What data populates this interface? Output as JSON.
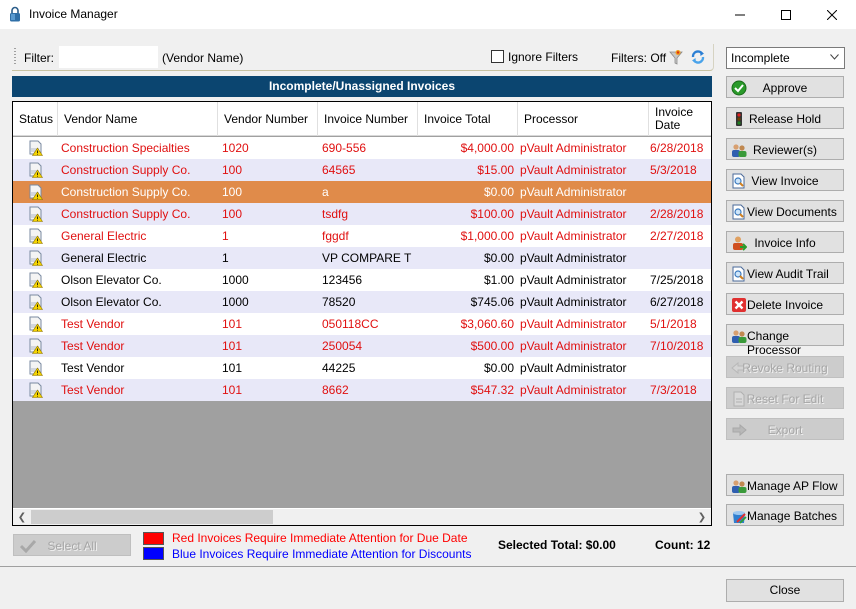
{
  "window": {
    "title": "Invoice Manager",
    "minimize_label": "minimize",
    "maximize_label": "maximize",
    "close_label": "close"
  },
  "filterbar": {
    "filter_label": "Filter:",
    "filter_value": "",
    "filter_hint": "(Vendor Name)",
    "ignore_filters_label": "Ignore Filters",
    "ignore_filters_checked": false,
    "filters_status": "Filters: Off"
  },
  "grid": {
    "title": "Incomplete/Unassigned Invoices",
    "columns": [
      {
        "key": "status",
        "label": "Status"
      },
      {
        "key": "vendor_name",
        "label": "Vendor Name"
      },
      {
        "key": "vendor_number",
        "label": "Vendor Number"
      },
      {
        "key": "invoice_number",
        "label": "Invoice Number"
      },
      {
        "key": "invoice_total",
        "label": "Invoice Total"
      },
      {
        "key": "processor",
        "label": "Processor"
      },
      {
        "key": "invoice_date",
        "label": "Invoice Date"
      }
    ],
    "rows": [
      {
        "status": "warning",
        "vendor_name": "Construction Specialties",
        "vendor_number": "1020",
        "invoice_number": "690-556",
        "invoice_total": "$4,000.00",
        "processor": "pVault Administrator",
        "invoice_date": "6/28/2018",
        "flag": "red",
        "selected": false
      },
      {
        "status": "warning",
        "vendor_name": "Construction Supply Co.",
        "vendor_number": "100",
        "invoice_number": "64565",
        "invoice_total": "$15.00",
        "processor": "pVault Administrator",
        "invoice_date": "5/3/2018",
        "flag": "red",
        "selected": false
      },
      {
        "status": "warning",
        "vendor_name": "Construction Supply Co.",
        "vendor_number": "100",
        "invoice_number": "a",
        "invoice_total": "$0.00",
        "processor": "pVault Administrator",
        "invoice_date": "",
        "flag": "black",
        "selected": true
      },
      {
        "status": "warning",
        "vendor_name": "Construction Supply Co.",
        "vendor_number": "100",
        "invoice_number": "tsdfg",
        "invoice_total": "$100.00",
        "processor": "pVault Administrator",
        "invoice_date": "2/28/2018",
        "flag": "red",
        "selected": false
      },
      {
        "status": "warning",
        "vendor_name": "General Electric",
        "vendor_number": "1",
        "invoice_number": "fggdf",
        "invoice_total": "$1,000.00",
        "processor": "pVault Administrator",
        "invoice_date": "2/27/2018",
        "flag": "red",
        "selected": false
      },
      {
        "status": "warning",
        "vendor_name": "General Electric",
        "vendor_number": "1",
        "invoice_number": "VP COMPARE T",
        "invoice_total": "$0.00",
        "processor": "pVault Administrator",
        "invoice_date": "",
        "flag": "black",
        "selected": false
      },
      {
        "status": "warning",
        "vendor_name": "Olson Elevator Co.",
        "vendor_number": "1000",
        "invoice_number": "123456",
        "invoice_total": "$1.00",
        "processor": "pVault Administrator",
        "invoice_date": "7/25/2018",
        "flag": "black",
        "selected": false
      },
      {
        "status": "warning",
        "vendor_name": "Olson Elevator Co.",
        "vendor_number": "1000",
        "invoice_number": "78520",
        "invoice_total": "$745.06",
        "processor": "pVault Administrator",
        "invoice_date": "6/27/2018",
        "flag": "black",
        "selected": false
      },
      {
        "status": "warning",
        "vendor_name": "Test Vendor",
        "vendor_number": "101",
        "invoice_number": "050118CC",
        "invoice_total": "$3,060.60",
        "processor": "pVault Administrator",
        "invoice_date": "5/1/2018",
        "flag": "red",
        "selected": false
      },
      {
        "status": "warning",
        "vendor_name": "Test Vendor",
        "vendor_number": "101",
        "invoice_number": "250054",
        "invoice_total": "$500.00",
        "processor": "pVault Administrator",
        "invoice_date": "7/10/2018",
        "flag": "red",
        "selected": false
      },
      {
        "status": "warning",
        "vendor_name": "Test Vendor",
        "vendor_number": "101",
        "invoice_number": "44225",
        "invoice_total": "$0.00",
        "processor": "pVault Administrator",
        "invoice_date": "",
        "flag": "black",
        "selected": false
      },
      {
        "status": "warning",
        "vendor_name": "Test Vendor",
        "vendor_number": "101",
        "invoice_number": "8662",
        "invoice_total": "$547.32",
        "processor": "pVault Administrator",
        "invoice_date": "7/3/2018",
        "flag": "red",
        "selected": false
      }
    ]
  },
  "sidebar": {
    "view_select": "Incomplete",
    "buttons": [
      {
        "id": "approve",
        "label": "Approve",
        "icon": "check-circle-icon",
        "enabled": true
      },
      {
        "id": "release-hold",
        "label": "Release Hold",
        "icon": "traffic-light-icon",
        "enabled": true
      },
      {
        "id": "reviewers",
        "label": "Reviewer(s)",
        "icon": "users-icon",
        "enabled": true
      },
      {
        "id": "view-invoice",
        "label": "View Invoice",
        "icon": "document-magnifier-icon",
        "enabled": true
      },
      {
        "id": "view-documents",
        "label": "View Documents",
        "icon": "document-magnifier-icon",
        "enabled": true
      },
      {
        "id": "invoice-info",
        "label": "Invoice Info",
        "icon": "user-arrow-icon",
        "enabled": true
      },
      {
        "id": "view-audit-trail",
        "label": "View Audit Trail",
        "icon": "document-magnifier-icon",
        "enabled": true
      },
      {
        "id": "delete-invoice",
        "label": "Delete Invoice",
        "icon": "red-x-icon",
        "enabled": true
      },
      {
        "id": "change-processor",
        "label": "Change Processor",
        "icon": "users-icon",
        "enabled": true
      },
      {
        "id": "revoke-routing",
        "label": "Revoke Routing",
        "icon": "arrow-left-icon",
        "enabled": false
      },
      {
        "id": "reset-for-edit",
        "label": "Reset For Edit",
        "icon": "document-reset-icon",
        "enabled": false
      },
      {
        "id": "export",
        "label": "Export",
        "icon": "arrow-right-icon",
        "enabled": false
      },
      {
        "id": "manage-ap-flow",
        "label": "Manage AP Flow",
        "icon": "users-icon",
        "enabled": true
      },
      {
        "id": "manage-batches",
        "label": "Manage Batches",
        "icon": "batch-box-icon",
        "enabled": true
      }
    ]
  },
  "footer": {
    "select_all_label": "Select All",
    "legend": [
      {
        "text": "Red Invoices Require Immediate Attention for Due Date",
        "color": "#ff0000"
      },
      {
        "text": "Blue Invoices Require Immediate Attention for Discounts",
        "color": "#0000ff"
      }
    ],
    "selected_total": "Selected Total: $0.00",
    "count": "Count: 12",
    "close_label": "Close"
  },
  "colors": {
    "grid_title_bg": "#0b4570",
    "selected_row_bg": "#e08b4a",
    "alt_row_bg": "#e8e8f8",
    "red_text": "#e01010"
  }
}
